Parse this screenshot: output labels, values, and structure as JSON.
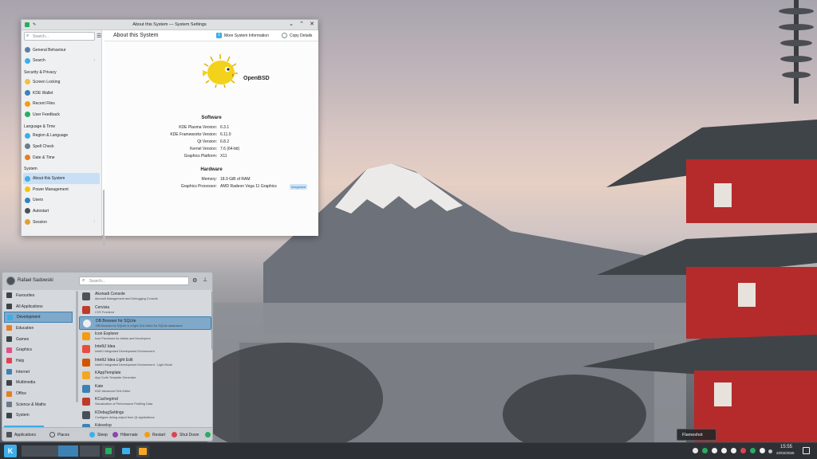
{
  "settings_window": {
    "title": "About this System — System Settings",
    "search_placeholder": "Search...",
    "sidebar": {
      "items": [
        {
          "label": "General Behaviour",
          "icon": "settings-icon",
          "color": "#5b7fa6",
          "chevron": false
        },
        {
          "label": "Search",
          "icon": "search-icon",
          "color": "#3daee9",
          "chevron": true
        },
        {
          "category": "Security & Privacy"
        },
        {
          "label": "Screen Locking",
          "icon": "lock-icon",
          "color": "#f0c040"
        },
        {
          "label": "KDE Wallet",
          "icon": "wallet-icon",
          "color": "#3d82b5"
        },
        {
          "label": "Recent Files",
          "icon": "clock-icon",
          "color": "#f39c12"
        },
        {
          "label": "User Feedback",
          "icon": "feedback-icon",
          "color": "#27ae60"
        },
        {
          "category": "Language & Time"
        },
        {
          "label": "Region & Language",
          "icon": "region-icon",
          "color": "#3daee9"
        },
        {
          "label": "Spell Check",
          "icon": "spellcheck-icon",
          "color": "#6c7a89"
        },
        {
          "label": "Date & Time",
          "icon": "date-icon",
          "color": "#e67e22"
        },
        {
          "category": "System"
        },
        {
          "label": "About this System",
          "icon": "info-icon",
          "color": "#3daee9",
          "active": true
        },
        {
          "label": "Power Management",
          "icon": "power-icon",
          "color": "#f1c40f"
        },
        {
          "label": "Users",
          "icon": "users-icon",
          "color": "#2e86c1"
        },
        {
          "label": "Autostart",
          "icon": "autostart-icon",
          "color": "#4a5057"
        },
        {
          "label": "Session",
          "icon": "session-icon",
          "color": "#e0a030",
          "chevron": true
        }
      ]
    },
    "content": {
      "page_title": "About this System",
      "more_info_label": "More System Information",
      "copy_label": "Copy Details",
      "os_name": "OpenBSD",
      "software_title": "Software",
      "software": [
        {
          "k": "KDE Plasma Version:",
          "v": "6.3.1"
        },
        {
          "k": "KDE Frameworks Version:",
          "v": "6.11.0"
        },
        {
          "k": "Qt Version:",
          "v": "6.8.2"
        },
        {
          "k": "Kernel Version:",
          "v": "7.6 (64-bit)"
        },
        {
          "k": "Graphics Platform:",
          "v": "X11"
        }
      ],
      "hardware_title": "Hardware",
      "hardware": [
        {
          "k": "Memory:",
          "v": "18.9 GiB of RAM"
        },
        {
          "k": "Graphics Processor:",
          "v": "AMD Radeon Vega 11 Graphics"
        }
      ],
      "integrated_badge": "Integrated"
    }
  },
  "launcher": {
    "user_name": "Rafael Sadowski",
    "search_placeholder": "Search...",
    "categories": [
      {
        "label": "Favourites",
        "color": "#3d4349"
      },
      {
        "label": "All Applications",
        "color": "#3d4349"
      },
      {
        "label": "Development",
        "color": "#3daee9",
        "active": true
      },
      {
        "label": "Education",
        "color": "#e67e22"
      },
      {
        "label": "Games",
        "color": "#3d4349"
      },
      {
        "label": "Graphics",
        "color": "#e74c8c"
      },
      {
        "label": "Help",
        "color": "#da4453"
      },
      {
        "label": "Internet",
        "color": "#3d82b5"
      },
      {
        "label": "Multimedia",
        "color": "#3d4349"
      },
      {
        "label": "Office",
        "color": "#e67e22"
      },
      {
        "label": "Science & Maths",
        "color": "#6c7a89"
      },
      {
        "label": "System",
        "color": "#3d4349"
      }
    ],
    "apps": [
      {
        "name": "Akonadi Console",
        "desc": "Akonadi Management and Debugging Console",
        "color": "#4d5359"
      },
      {
        "name": "Cervisia",
        "desc": "CVS Frontend",
        "color": "#c0392b"
      },
      {
        "name": "DB Browser for SQLite",
        "desc": "DB Browser for SQLite is a light GUI editor for SQLite databases",
        "color": "#eceff1",
        "active": true
      },
      {
        "name": "Icon Explorer",
        "desc": "Icon Previewer for Artists and Developers",
        "color": "#f39c12"
      },
      {
        "name": "IntelliJ Idea",
        "desc": "IntelliJ Integrated Development Environment",
        "color": "#e74c3c"
      },
      {
        "name": "IntelliJ Idea Light Edit",
        "desc": "IntelliJ Integrated Development Environment - Light Mode",
        "color": "#d35400"
      },
      {
        "name": "KAppTemplate",
        "desc": "App Code Template Generator",
        "color": "#f5a623"
      },
      {
        "name": "Kate",
        "desc": "KDE Advanced Text Editor",
        "color": "#3d82b5"
      },
      {
        "name": "KCachegrind",
        "desc": "Visualization of Performance Profiling Data",
        "color": "#c0392b"
      },
      {
        "name": "KDebugSettings",
        "desc": "Configure debug output from Qt applications",
        "color": "#4a5057"
      },
      {
        "name": "Kdevelop",
        "desc": "",
        "color": "#3d82b5"
      }
    ],
    "footer": {
      "applications": "Applications",
      "places": "Places",
      "sleep": "Sleep",
      "hibernate": "Hibernate",
      "restart": "Restart",
      "shutdown": "Shut Down"
    }
  },
  "taskbar": {
    "time": "15:55",
    "date": "22/02/2025",
    "tooltip": "Flameshot"
  }
}
